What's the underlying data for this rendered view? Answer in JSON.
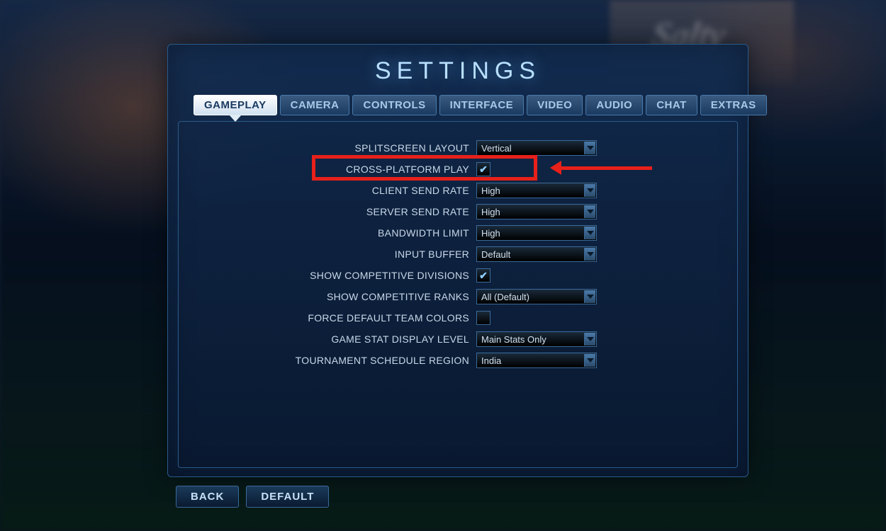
{
  "title": "SETTINGS",
  "tabs": [
    {
      "label": "GAMEPLAY",
      "active": true
    },
    {
      "label": "CAMERA",
      "active": false
    },
    {
      "label": "CONTROLS",
      "active": false
    },
    {
      "label": "INTERFACE",
      "active": false
    },
    {
      "label": "VIDEO",
      "active": false
    },
    {
      "label": "AUDIO",
      "active": false
    },
    {
      "label": "CHAT",
      "active": false
    },
    {
      "label": "EXTRAS",
      "active": false
    }
  ],
  "settings": {
    "splitscreen_layout": {
      "label": "SPLITSCREEN LAYOUT",
      "type": "dropdown",
      "value": "Vertical"
    },
    "cross_platform_play": {
      "label": "CROSS-PLATFORM PLAY",
      "type": "checkbox",
      "value": true
    },
    "client_send_rate": {
      "label": "CLIENT SEND RATE",
      "type": "dropdown",
      "value": "High"
    },
    "server_send_rate": {
      "label": "SERVER SEND RATE",
      "type": "dropdown",
      "value": "High"
    },
    "bandwidth_limit": {
      "label": "BANDWIDTH LIMIT",
      "type": "dropdown",
      "value": "High"
    },
    "input_buffer": {
      "label": "INPUT BUFFER",
      "type": "dropdown",
      "value": "Default"
    },
    "show_competitive_divisions": {
      "label": "SHOW COMPETITIVE DIVISIONS",
      "type": "checkbox",
      "value": true
    },
    "show_competitive_ranks": {
      "label": "SHOW COMPETITIVE RANKS",
      "type": "dropdown",
      "value": "All (Default)"
    },
    "force_default_team_colors": {
      "label": "FORCE DEFAULT TEAM COLORS",
      "type": "checkbox",
      "value": false
    },
    "game_stat_display_level": {
      "label": "GAME STAT DISPLAY LEVEL",
      "type": "dropdown",
      "value": "Main Stats Only"
    },
    "tournament_schedule_region": {
      "label": "TOURNAMENT SCHEDULE REGION",
      "type": "dropdown",
      "value": "India"
    }
  },
  "footer": {
    "back": "BACK",
    "default": "DEFAULT"
  },
  "annotation": {
    "target": "cross_platform_play"
  }
}
